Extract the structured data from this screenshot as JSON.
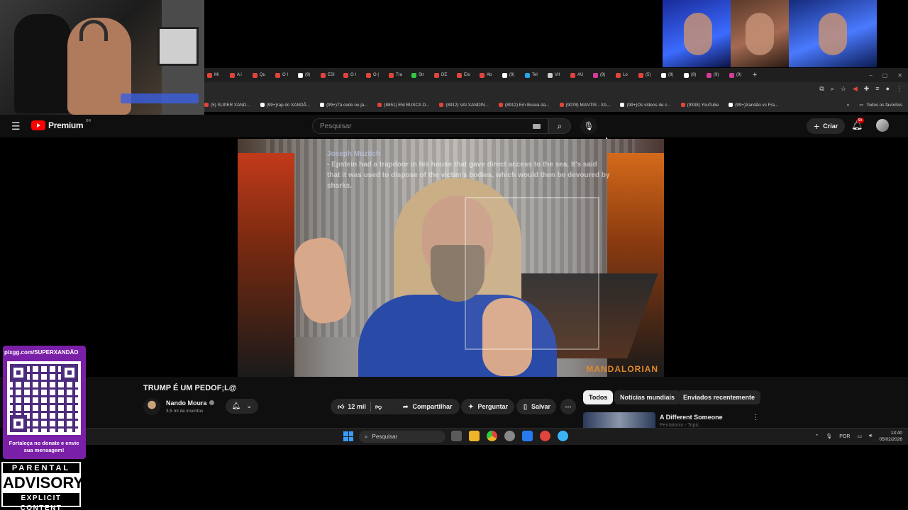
{
  "browser": {
    "tabs": [
      {
        "label": "Mi",
        "color": "#e0443a"
      },
      {
        "label": "A i",
        "color": "#e0443a"
      },
      {
        "label": "Qu",
        "color": "#e0443a"
      },
      {
        "label": "O I",
        "color": "#e0443a"
      },
      {
        "label": "(9)",
        "color": "#ffffff"
      },
      {
        "label": "ESI",
        "color": "#e0443a"
      },
      {
        "label": "O I",
        "color": "#e0443a"
      },
      {
        "label": "O (",
        "color": "#e0443a"
      },
      {
        "label": "Tra",
        "color": "#e0443a"
      },
      {
        "label": "Str",
        "color": "#2ecc40"
      },
      {
        "label": "DE",
        "color": "#e0443a"
      },
      {
        "label": "Elo",
        "color": "#e0443a"
      },
      {
        "label": "Ab",
        "color": "#e0443a"
      },
      {
        "label": "(9)",
        "color": "#ffffff"
      },
      {
        "label": "Tel",
        "color": "#2aa3ef"
      },
      {
        "label": "VII",
        "color": "#cccccc"
      },
      {
        "label": "AU",
        "color": "#e0443a"
      },
      {
        "label": "(9)",
        "color": "#d63a9a"
      },
      {
        "label": "Lo",
        "color": "#e0443a"
      },
      {
        "label": "(5)",
        "color": "#e0443a"
      },
      {
        "label": "(9)",
        "color": "#ffffff"
      },
      {
        "label": "(9)",
        "color": "#ffffff"
      },
      {
        "label": "(9)",
        "color": "#d63a9a"
      },
      {
        "label": "(9)",
        "color": "#d63a9a"
      }
    ],
    "new_tab": "+",
    "window_controls": [
      "–",
      "▢",
      "✕"
    ],
    "bookmarks": [
      {
        "label": "(5) SUPER XAND...",
        "color": "#e0443a"
      },
      {
        "label": "(99+)rap do XANDÃ...",
        "color": "#ffffff"
      },
      {
        "label": "(99+)Tá cedo ou já...",
        "color": "#ffffff"
      },
      {
        "label": "(8851) EM BUSCA D...",
        "color": "#e0443a"
      },
      {
        "label": "(8912) VAI XANDIN...",
        "color": "#e0443a"
      },
      {
        "label": "(8912) Em Busca da...",
        "color": "#e0443a"
      },
      {
        "label": "(9078) MANTIS - XA...",
        "color": "#e0443a"
      },
      {
        "label": "(99+)Os vídeos de c...",
        "color": "#ffffff"
      },
      {
        "label": "(9338) YouTube",
        "color": "#e0443a"
      },
      {
        "label": "(99+)Xandão vs Fra...",
        "color": "#ffffff"
      }
    ],
    "bookmarks_more": "»",
    "all_bookmarks": "Todos os favoritos"
  },
  "youtube": {
    "logo_text": "Premium",
    "region": "BR",
    "search_placeholder": "Pesquisar",
    "create_label": "Criar",
    "notification_count": "9+"
  },
  "video": {
    "comment_author": "Joseph Muztich",
    "comment_text": "- Epstein had a trapdoor in his house that gave direct access to the sea. It's said that it was used to dispose of the victim's bodies, which would then be devoured by sharks.",
    "in_video_text": "MANDALORIAN",
    "title": "TRUMP É UM PEDOF;L@",
    "channel_name": "Nando Moura",
    "subscribers": "3,5 mi de inscritos",
    "likes": "12 mil",
    "share_label": "Compartilhar",
    "ask_label": "Perguntar",
    "save_label": "Salvar"
  },
  "filter_chips": [
    {
      "label": "Todos",
      "active": true
    },
    {
      "label": "Notícias mundiais",
      "active": false
    },
    {
      "label": "Enviados recentemente",
      "active": false
    }
  ],
  "recommendation": {
    "title": "A Different Someone",
    "channel": "Pentatonix - Topic"
  },
  "taskbar": {
    "search_placeholder": "Pesquisar",
    "language": "POR",
    "time": "13:40",
    "date": "05/02/2026"
  },
  "overlay": {
    "pix_url": "pixgg.com/SUPERXANDÃO",
    "qr_caption": "Fortaleça no donate e envie sua mensagem!",
    "advisory_top": "PARENTAL",
    "advisory_mid": "ADVISORY",
    "advisory_bottom": "EXPLICIT CONTENT"
  }
}
